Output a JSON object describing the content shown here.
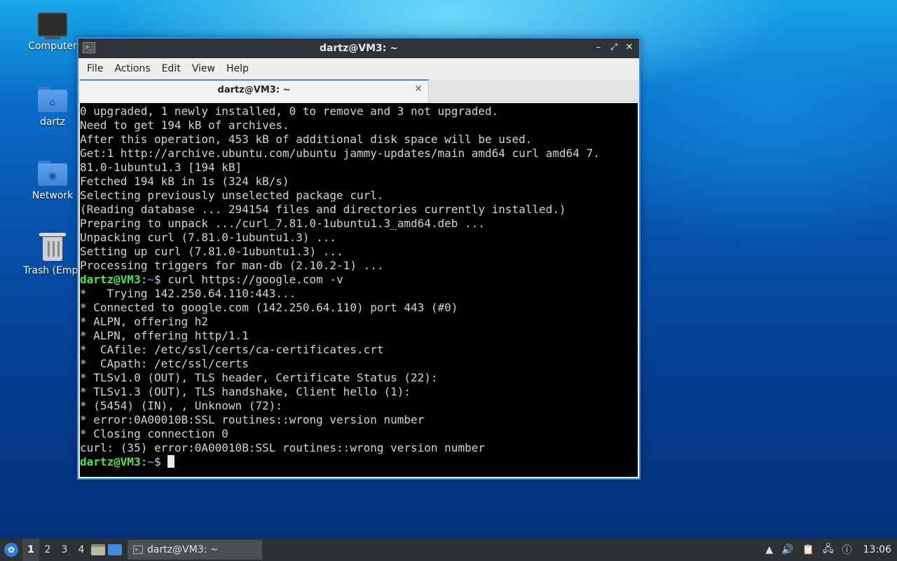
{
  "desktop": {
    "icons": [
      {
        "label": "Computer"
      },
      {
        "label": "dartz"
      },
      {
        "label": "Network"
      },
      {
        "label": "Trash (Empt"
      }
    ]
  },
  "window": {
    "title": "dartz@VM3: ~",
    "controls": {
      "minimize": "–",
      "maximize": "⤢",
      "close": "✕"
    },
    "menu": [
      "File",
      "Actions",
      "Edit",
      "View",
      "Help"
    ],
    "tab": {
      "title": "dartz@VM3: ~",
      "close": "✕"
    }
  },
  "terminal": {
    "prompt_user": "dartz@VM3",
    "prompt_sep": ":",
    "prompt_path": "~",
    "prompt_symbol": "$ ",
    "lines": [
      "0 upgraded, 1 newly installed, 0 to remove and 3 not upgraded.",
      "Need to get 194 kB of archives.",
      "After this operation, 453 kB of additional disk space will be used.",
      "Get:1 http://archive.ubuntu.com/ubuntu jammy-updates/main amd64 curl amd64 7.",
      "81.0-1ubuntu1.3 [194 kB]",
      "Fetched 194 kB in 1s (324 kB/s)",
      "Selecting previously unselected package curl.",
      "(Reading database ... 294154 files and directories currently installed.)",
      "Preparing to unpack .../curl_7.81.0-1ubuntu1.3_amd64.deb ...",
      "Unpacking curl (7.81.0-1ubuntu1.3) ...",
      "Setting up curl (7.81.0-1ubuntu1.3) ...",
      "Processing triggers for man-db (2.10.2-1) ..."
    ],
    "command": "curl https://google.com -v",
    "output": [
      "*   Trying 142.250.64.110:443...",
      "* Connected to google.com (142.250.64.110) port 443 (#0)",
      "* ALPN, offering h2",
      "* ALPN, offering http/1.1",
      "*  CAfile: /etc/ssl/certs/ca-certificates.crt",
      "*  CApath: /etc/ssl/certs",
      "* TLSv1.0 (OUT), TLS header, Certificate Status (22):",
      "* TLSv1.3 (OUT), TLS handshake, Client hello (1):",
      "* (5454) (IN), , Unknown (72):",
      "* error:0A00010B:SSL routines::wrong version number",
      "* Closing connection 0",
      "curl: (35) error:0A00010B:SSL routines::wrong version number"
    ]
  },
  "taskbar": {
    "workspaces": [
      "1",
      "2",
      "3",
      "4"
    ],
    "task_label": "dartz@VM3: ~",
    "clock": "13:06"
  },
  "colors": {
    "accent": "#3d8ee0",
    "prompt_user": "#4ee24e",
    "prompt_path": "#4b7cf0"
  }
}
